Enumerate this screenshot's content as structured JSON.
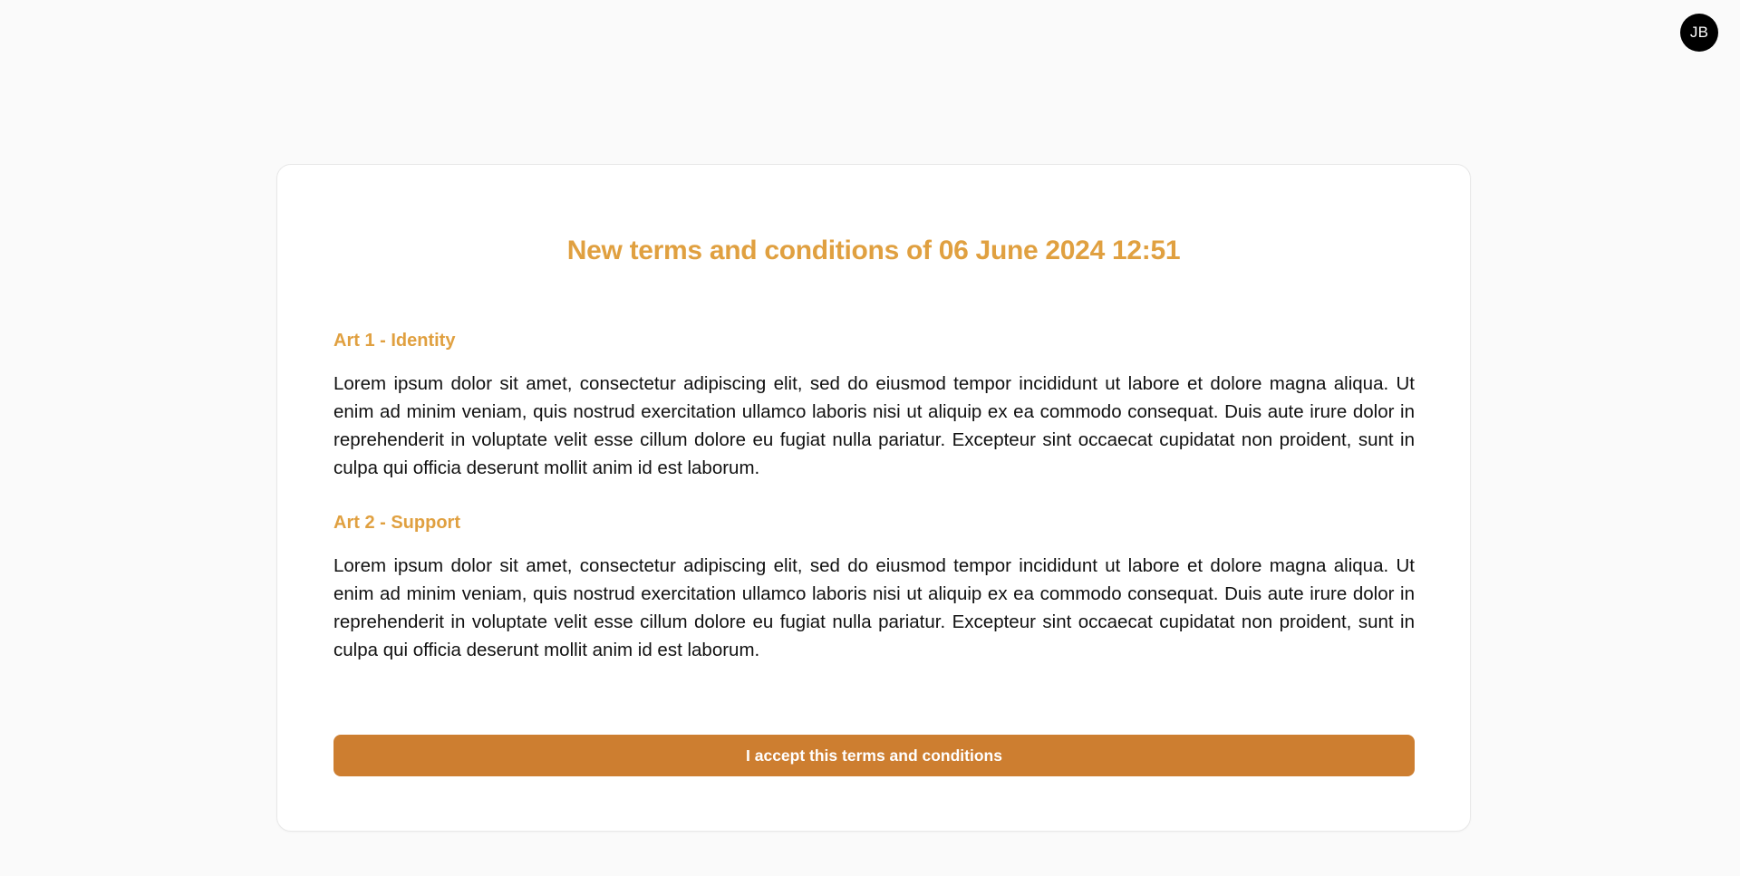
{
  "user": {
    "initials": "JB"
  },
  "terms": {
    "title": "New terms and conditions of 06 June 2024 12:51",
    "sections": [
      {
        "heading": "Art 1 - Identity",
        "body": "Lorem ipsum dolor sit amet, consectetur adipiscing elit, sed do eiusmod tempor incididunt ut labore et dolore magna aliqua. Ut enim ad minim veniam, quis nostrud exercitation ullamco laboris nisi ut aliquip ex ea commodo consequat. Duis aute irure dolor in reprehenderit in voluptate velit esse cillum dolore eu fugiat nulla pariatur. Excepteur sint occaecat cupidatat non proident, sunt in culpa qui officia deserunt mollit anim id est laborum."
      },
      {
        "heading": "Art 2 - Support",
        "body": "Lorem ipsum dolor sit amet, consectetur adipiscing elit, sed do eiusmod tempor incididunt ut labore et dolore magna aliqua. Ut enim ad minim veniam, quis nostrud exercitation ullamco laboris nisi ut aliquip ex ea commodo consequat. Duis aute irure dolor in reprehenderit in voluptate velit esse cillum dolore eu fugiat nulla pariatur. Excepteur sint occaecat cupidatat non proident, sunt in culpa qui officia deserunt mollit anim id est laborum."
      }
    ],
    "accept_label": "I accept this terms and conditions"
  },
  "colors": {
    "accent": "#e0a040",
    "button": "#cd7e30",
    "avatar_bg": "#000000",
    "page_bg": "#fafafa"
  }
}
